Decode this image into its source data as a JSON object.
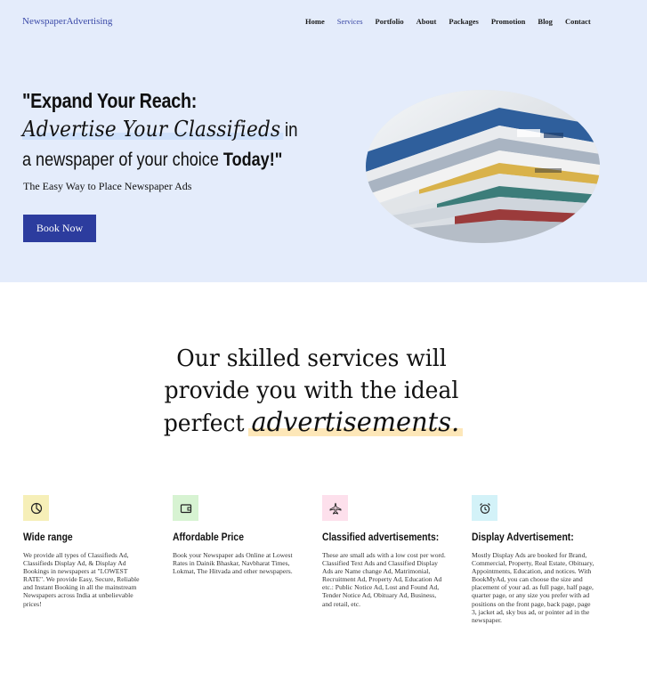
{
  "header": {
    "logo": "NewspaperAdvertising",
    "nav": [
      "Home",
      "Services",
      "Portfolio",
      "About",
      "Packages",
      "Promotion",
      "Blog",
      "Contact"
    ],
    "active_nav": "Services"
  },
  "hero": {
    "line1": "\"Expand Your Reach:",
    "line2_script": "Advertise Your Classifieds",
    "line2_in": "in",
    "line3_prefix": "a newspaper of your choice ",
    "line3_bold": "Today!\"",
    "subtitle": "The Easy Way to Place Newspaper Ads",
    "cta": "Book Now"
  },
  "services": {
    "title_line1": "Our skilled services will",
    "title_line2": "provide you with the ideal",
    "title_line3_prefix": "perfect ",
    "title_line3_highlight": "advertisements."
  },
  "cards": [
    {
      "icon": "pie-chart-icon",
      "icon_bg": "#f6efb8",
      "title": "Wide range",
      "text": "We provide all types of Classifieds Ad, Classifieds Display Ad, & Display Ad Bookings in newspapers at \"LOWEST RATE\". We provide Easy, Secure, Reliable and Instant Booking in all the mainstream Newspapers across India at unbelievable prices!"
    },
    {
      "icon": "wallet-icon",
      "icon_bg": "#d7f3d2",
      "title": "Affordable Price",
      "text": "Book your Newspaper ads Online at Lowest Rates in Dainik Bhaskar, Navbharat Times, Lokmat, The Hitvada and other newspapers."
    },
    {
      "icon": "airplane-icon",
      "icon_bg": "#fde0ec",
      "title": "Classified advertisements:",
      "text": "These are small ads with a low cost per word. Classified Text Ads and Classified Display Ads are Name change Ad, Matrimonial, Recruitment Ad, Property Ad, Education Ad etc.: Public Notice Ad, Lost and Found Ad, Tender Notice Ad, Obituary Ad, Business, and retail, etc."
    },
    {
      "icon": "alarm-clock-icon",
      "icon_bg": "#d3f2f8",
      "title": "Display Advertisement:",
      "text": "Mostly Display Ads are booked for Brand, Commercial, Property, Real Estate, Obituary, Appointments, Education, and notices. With BookMyAd, you can choose the size and placement of your ad. as full page, half page, quarter page, or any size you prefer with ad positions on the front page, back page, page 3, jacket ad, sky bus ad, or pointer ad in the newspaper."
    }
  ],
  "colors": {
    "hero_bg": "#e4ecfb",
    "accent": "#2c3c9e",
    "script_highlight": "#cfe1fb",
    "title_highlight": "#fde7b8"
  }
}
